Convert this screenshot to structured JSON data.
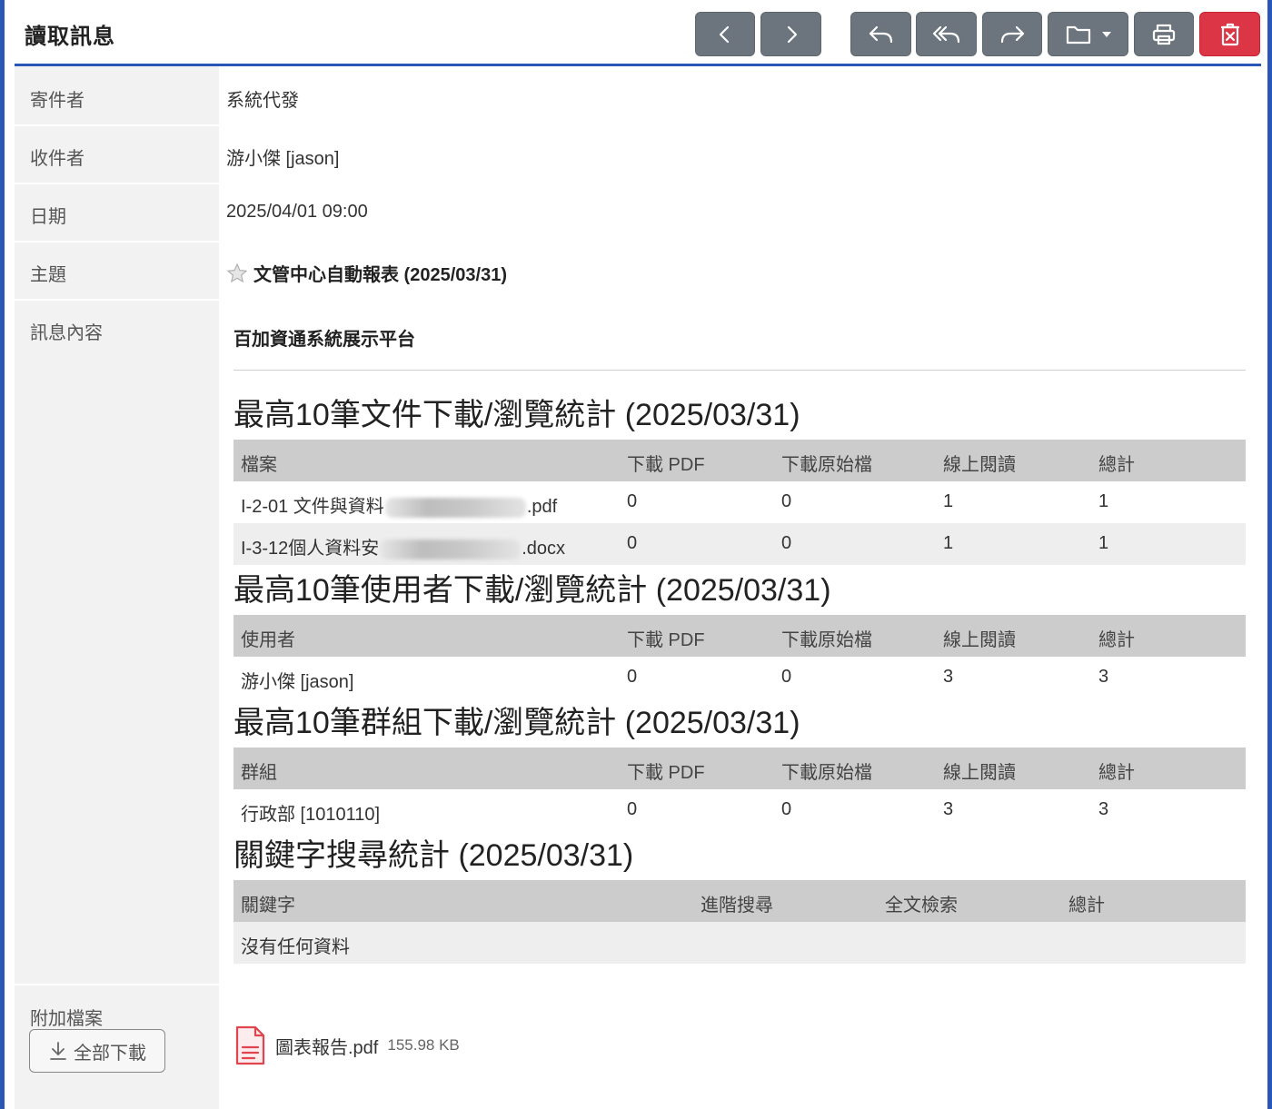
{
  "header": {
    "title": "讀取訊息"
  },
  "toolbar": {
    "buttons": [
      {
        "icon": "chevron-left-icon"
      },
      {
        "icon": "chevron-right-icon"
      },
      {
        "icon": "reply-icon"
      },
      {
        "icon": "reply-all-icon"
      },
      {
        "icon": "forward-icon"
      },
      {
        "icon": "folder-icon"
      },
      {
        "icon": "print-icon"
      },
      {
        "icon": "delete-icon"
      }
    ]
  },
  "fields": {
    "sender_label": "寄件者",
    "sender_value": "系統代發",
    "recipient_label": "收件者",
    "recipient_value": "游小傑 [jason]",
    "date_label": "日期",
    "date_value": "2025/04/01 09:00",
    "subject_label": "主題",
    "subject_value": "文管中心自動報表 (2025/03/31)",
    "body_label": "訊息內容",
    "attachments_label": "附加檔案"
  },
  "message": {
    "org_title": "百加資通系統展示平台",
    "sections": [
      {
        "heading": "最高10筆文件下載/瀏覽統計 (2025/03/31)",
        "columns": [
          "檔案",
          "下載 PDF",
          "下載原始檔",
          "線上閱讀",
          "總計"
        ],
        "rows": [
          {
            "name_start": "I-2-01 文件與資料",
            "name_end": ".pdf",
            "pdf": "0",
            "orig": "0",
            "online": "1",
            "total": "1"
          },
          {
            "name_start": "I-3-12個人資料安",
            "name_end": ".docx",
            "pdf": "0",
            "orig": "0",
            "online": "1",
            "total": "1"
          }
        ]
      },
      {
        "heading": "最高10筆使用者下載/瀏覽統計 (2025/03/31)",
        "columns": [
          "使用者",
          "下載 PDF",
          "下載原始檔",
          "線上閱讀",
          "總計"
        ],
        "rows": [
          {
            "name": "游小傑 [jason]",
            "pdf": "0",
            "orig": "0",
            "online": "3",
            "total": "3"
          }
        ]
      },
      {
        "heading": "最高10筆群組下載/瀏覽統計 (2025/03/31)",
        "columns": [
          "群組",
          "下載 PDF",
          "下載原始檔",
          "線上閱讀",
          "總計"
        ],
        "rows": [
          {
            "name": "行政部 [1010110]",
            "pdf": "0",
            "orig": "0",
            "online": "3",
            "total": "3"
          }
        ]
      },
      {
        "heading": "關鍵字搜尋統計 (2025/03/31)",
        "columns": [
          "關鍵字",
          "進階搜尋",
          "全文檢索",
          "總計"
        ],
        "empty_text": "沒有任何資料"
      }
    ]
  },
  "attachments": {
    "download_all_label": "全部下載",
    "files": [
      {
        "name": "圖表報告.pdf",
        "size": "155.98 KB",
        "icon": "pdf-file-icon"
      }
    ]
  },
  "colors": {
    "brand_blue": "#2a57b5",
    "button_gray": "#6c757d",
    "danger_red": "#dc3545",
    "pdf_red": "#e0444f"
  }
}
